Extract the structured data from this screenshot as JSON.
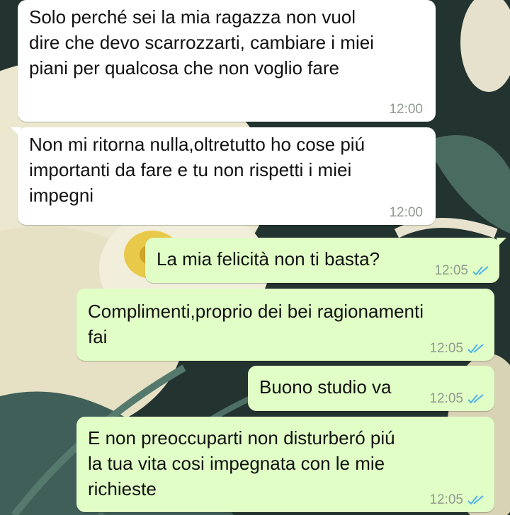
{
  "colors": {
    "incoming_bubble": "#ffffff",
    "outgoing_bubble": "#e1fec6",
    "read_ticks": "#4fb3e8",
    "timestamp": "#8f9a8f"
  },
  "messages": [
    {
      "direction": "incoming",
      "text": "Solo perché sei la mia ragazza non vuol\ndire che devo scarrozzarti, cambiare i miei\npiani per qualcosa che non voglio fare",
      "time": "12:00"
    },
    {
      "direction": "incoming",
      "text": "Non mi ritorna nulla,oltretutto ho cose piú\nimportanti da fare e tu non rispetti i miei\nimpegni",
      "time": "12:00"
    },
    {
      "direction": "outgoing",
      "text": "La mia felicità non ti basta?",
      "time": "12:05",
      "status_icon": "double-check-read-icon"
    },
    {
      "direction": "outgoing",
      "text": "Complimenti,proprio dei bei ragionamenti\nfai",
      "time": "12:05",
      "status_icon": "double-check-read-icon"
    },
    {
      "direction": "outgoing",
      "text": "Buono studio va",
      "time": "12:05",
      "status_icon": "double-check-read-icon"
    },
    {
      "direction": "outgoing",
      "text": "E non preoccuparti non disturberó piú\nla tua vita cosi impegnata con le mie\nrichieste",
      "time": "12:05",
      "status_icon": "double-check-read-icon"
    }
  ]
}
